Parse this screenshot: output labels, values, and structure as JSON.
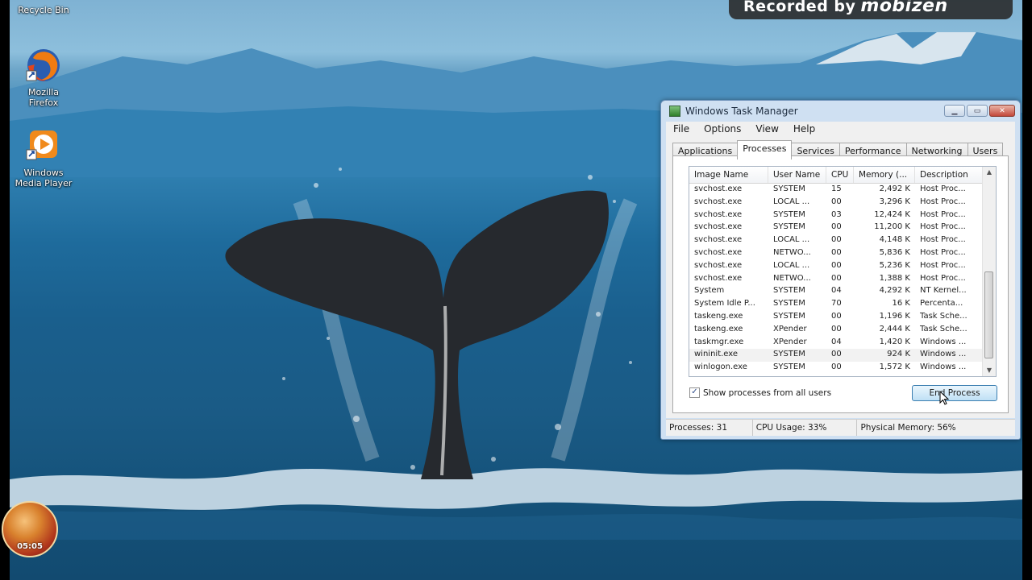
{
  "desktop": {
    "icons": [
      {
        "label": "Recycle Bin",
        "icon": "recycle-bin-icon"
      },
      {
        "label": "Mozilla\nFirefox",
        "icon": "firefox-icon"
      },
      {
        "label": "Windows\nMedia Player",
        "icon": "media-player-icon"
      }
    ]
  },
  "overlay": {
    "recorded_text": "Recorded by",
    "brand": "mobizen",
    "avatar_time": "05:05"
  },
  "task_manager": {
    "title": "Windows Task Manager",
    "menu": [
      "File",
      "Options",
      "View",
      "Help"
    ],
    "tabs": [
      "Applications",
      "Processes",
      "Services",
      "Performance",
      "Networking",
      "Users"
    ],
    "active_tab": "Processes",
    "columns": [
      "Image Name",
      "User Name",
      "CPU",
      "Memory (...",
      "Description"
    ],
    "rows": [
      [
        "svchost.exe",
        "SYSTEM",
        "15",
        "2,492 K",
        "Host Proc..."
      ],
      [
        "svchost.exe",
        "LOCAL ...",
        "00",
        "3,296 K",
        "Host Proc..."
      ],
      [
        "svchost.exe",
        "SYSTEM",
        "03",
        "12,424 K",
        "Host Proc..."
      ],
      [
        "svchost.exe",
        "SYSTEM",
        "00",
        "11,200 K",
        "Host Proc..."
      ],
      [
        "svchost.exe",
        "LOCAL ...",
        "00",
        "4,148 K",
        "Host Proc..."
      ],
      [
        "svchost.exe",
        "NETWO...",
        "00",
        "5,836 K",
        "Host Proc..."
      ],
      [
        "svchost.exe",
        "LOCAL ...",
        "00",
        "5,236 K",
        "Host Proc..."
      ],
      [
        "svchost.exe",
        "NETWO...",
        "00",
        "1,388 K",
        "Host Proc..."
      ],
      [
        "System",
        "SYSTEM",
        "04",
        "4,292 K",
        "NT Kernel..."
      ],
      [
        "System Idle P...",
        "SYSTEM",
        "70",
        "16 K",
        "Percenta..."
      ],
      [
        "taskeng.exe",
        "SYSTEM",
        "00",
        "1,196 K",
        "Task Sche..."
      ],
      [
        "taskeng.exe",
        "XPender",
        "00",
        "2,444 K",
        "Task Sche..."
      ],
      [
        "taskmgr.exe",
        "XPender",
        "04",
        "1,420 K",
        "Windows ..."
      ],
      [
        "wininit.exe",
        "SYSTEM",
        "00",
        "924 K",
        "Windows ..."
      ],
      [
        "winlogon.exe",
        "SYSTEM",
        "00",
        "1,572 K",
        "Windows ..."
      ]
    ],
    "show_all_label": "Show processes from all users",
    "show_all_checked": "✓",
    "end_process_label": "End Process",
    "status": {
      "processes": "Processes: 31",
      "cpu": "CPU Usage: 33%",
      "memory": "Physical Memory: 56%"
    }
  }
}
